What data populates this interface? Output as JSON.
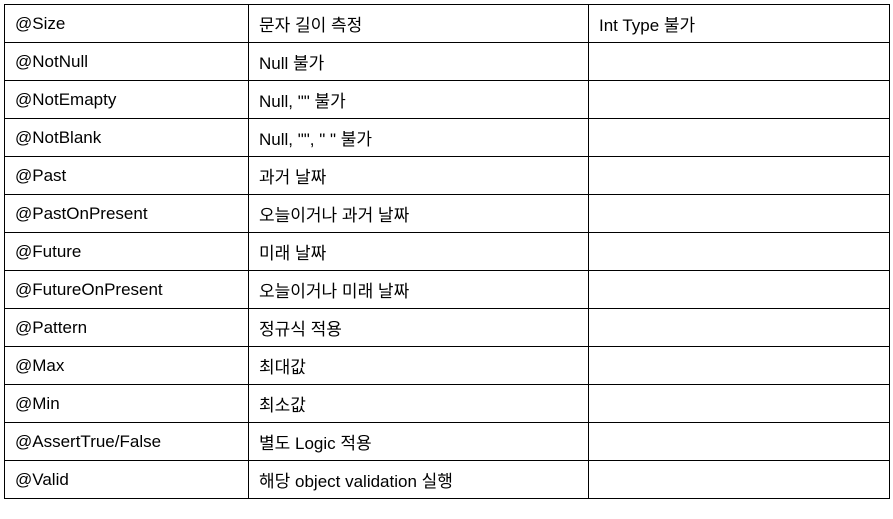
{
  "rows": [
    {
      "annotation": "@Size",
      "description": "문자 길이 측정",
      "note": "Int Type 불가"
    },
    {
      "annotation": "@NotNull",
      "description": "Null 불가",
      "note": ""
    },
    {
      "annotation": "@NotEmapty",
      "description": "Null, \"\" 불가",
      "note": ""
    },
    {
      "annotation": "@NotBlank",
      "description": "Null, \"\", \" \" 불가",
      "note": ""
    },
    {
      "annotation": "@Past",
      "description": "과거 날짜",
      "note": ""
    },
    {
      "annotation": "@PastOnPresent",
      "description": "오늘이거나 과거 날짜",
      "note": ""
    },
    {
      "annotation": "@Future",
      "description": "미래 날짜",
      "note": ""
    },
    {
      "annotation": "@FutureOnPresent",
      "description": "오늘이거나 미래 날짜",
      "note": ""
    },
    {
      "annotation": "@Pattern",
      "description": "정규식 적용",
      "note": ""
    },
    {
      "annotation": "@Max",
      "description": "최대값",
      "note": ""
    },
    {
      "annotation": "@Min",
      "description": "최소값",
      "note": ""
    },
    {
      "annotation": "@AssertTrue/False",
      "description": "별도 Logic 적용",
      "note": ""
    },
    {
      "annotation": "@Valid",
      "description": "해당 object validation 실행",
      "note": ""
    }
  ]
}
